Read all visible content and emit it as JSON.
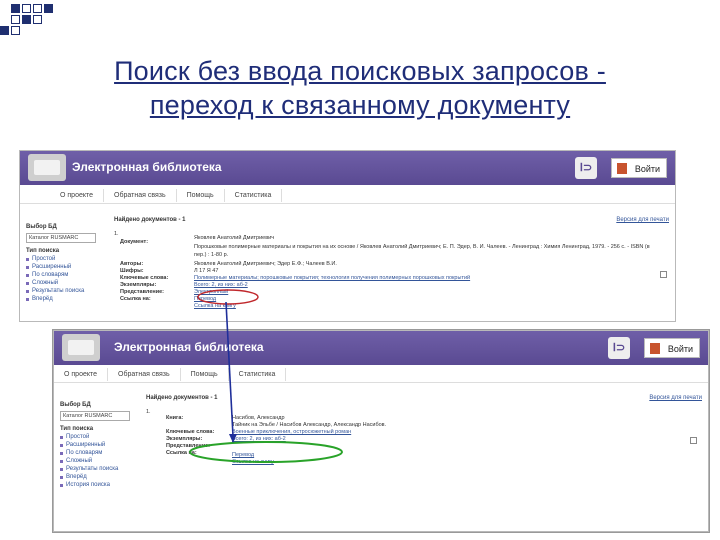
{
  "slide_title": {
    "line1": "Поиск без ввода поисковых запросов -",
    "line2": "переход к связанному документу"
  },
  "colors": {
    "title": "#1f2d78",
    "header": "#5e4e96",
    "ellipse": "#29a329",
    "arrow": "#1f2f9a"
  },
  "screen1": {
    "app_title": "Электронная библиотека",
    "login_label": "Войти",
    "nav": [
      "О проекте",
      "Обратная связь",
      "Помощь",
      "Статистика"
    ],
    "db_label": "Выбор БД",
    "db_value": "Каталог RUSMARC",
    "search_type_label": "Тип поиска",
    "search_types": [
      "Простой",
      "Расширенный",
      "По словарям",
      "Сложный",
      "Результаты поиска",
      "Вперёд"
    ],
    "found": "Найдено документов - 1",
    "print": "Версия для печати",
    "record_no": "1.",
    "labels": [
      "Документ:",
      "Авторы:",
      "Шифры:",
      "Ключевые слова:",
      "Экземпляры:",
      "Представление:",
      "Ссылка на:"
    ],
    "doc_text1": "Яковлев Анатолий Дмитриевич",
    "doc_text2": "Порошковые полимерные материалы и покрытия на их основе / Яковлев Анатолий Дмитриевич; Е. П. Эдер, В. И. Чалеев. - Ленинград : Химия Ленинград, 1979. - 256 с. - ISBN (в пер.) : 1-80 р.",
    "authors": "Яковлев Анатолий Дмитриевич; Эдер Е.Ф.; Чалеев В.И.",
    "codes": "Л 17  Я 47",
    "keywords": "Полимерные материалы; порошковые покрытия; технология получения полимерных порошковых покрытий",
    "copies": "Всего: 2, из них: аб-2",
    "view": "Электронный",
    "link1": "Перевод",
    "link2": "Ссылка на книгу"
  },
  "screen2": {
    "app_title": "Электронная библиотека",
    "login_label": "Войти",
    "nav": [
      "О проекте",
      "Обратная связь",
      "Помощь",
      "Статистика"
    ],
    "db_label": "Выбор БД",
    "db_value": "Каталог RUSMARC",
    "search_type_label": "Тип поиска",
    "search_types": [
      "Простой",
      "Расширенный",
      "По словарям",
      "Сложный",
      "Результаты поиска",
      "Вперёд",
      "История поиска"
    ],
    "found": "Найдено документов - 1",
    "print": "Версия для печати",
    "record_no": "1.",
    "labels": [
      "Книга:",
      "Ключевые слова:",
      "Экземпляры:",
      "Представление:",
      "Ссылка на:"
    ],
    "author": "Насибов, Александр",
    "title_line": "Тайник на Эльбе / Насибов Александр, Александр Насибов.",
    "keywords": "Военные приключения, остросюжетный роман",
    "copies": "Всего: 2, из них: аб-2",
    "link1": "Перевод",
    "link2": "Ссылка на книгу"
  }
}
